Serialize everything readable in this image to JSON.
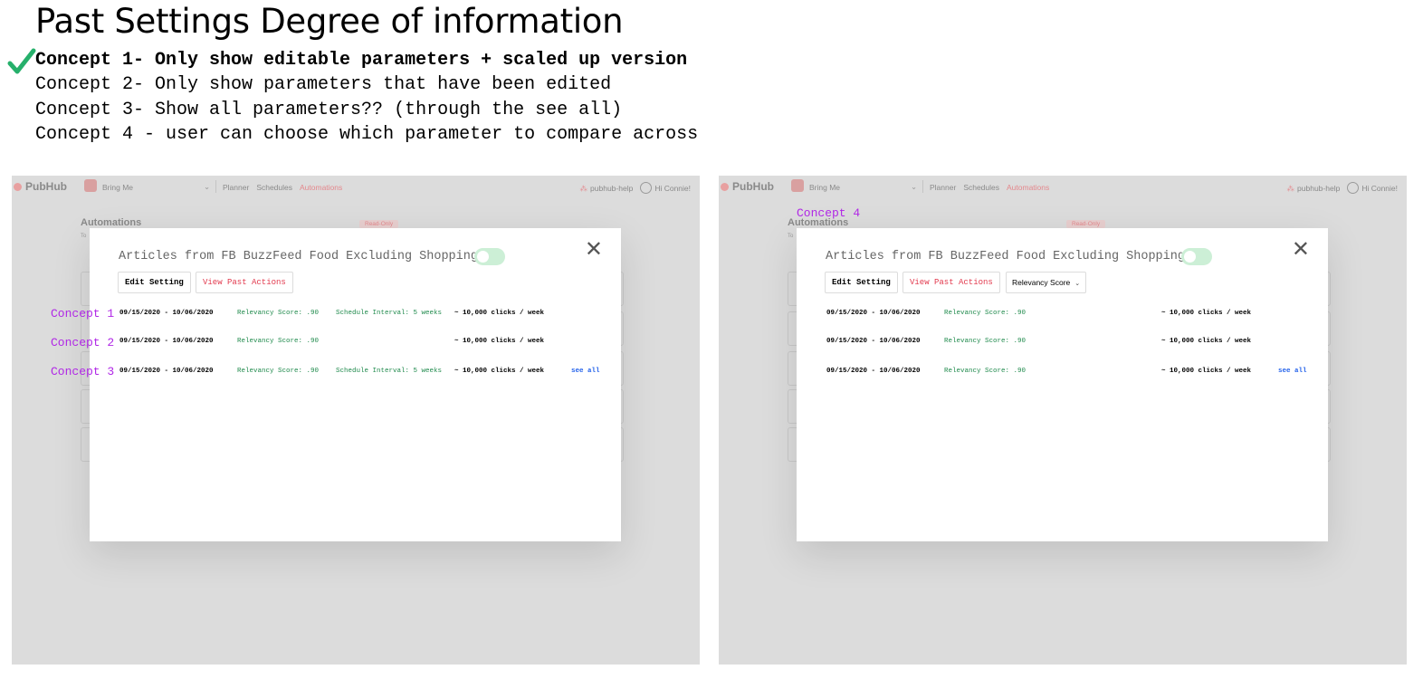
{
  "page_title": "Past Settings Degree of information",
  "concepts": [
    "Concept 1- Only show editable parameters + scaled up version",
    "Concept 2- Only show parameters that have been edited",
    "Concept 3- Show all parameters?? (through the see all)",
    "Concept 4 - user can choose which parameter to compare across"
  ],
  "colors": {
    "check": "#26b06b",
    "concept_label": "#b027e6",
    "accent_red": "#e23a4e",
    "green_text": "#1f8a4c",
    "link": "#2563eb"
  },
  "app": {
    "brand": "PubHub",
    "workspace": "Bring Me",
    "nav": [
      "Planner",
      "Schedules",
      "Automations"
    ],
    "active_nav": "Automations",
    "help": "pubhub-help",
    "user": "Hi Connie!",
    "bg_title": "Automations",
    "bg_sub": "To",
    "bg_badge": "Read-Only"
  },
  "modal": {
    "title": "Articles from FB BuzzFeed Food Excluding Shopping",
    "edit_button": "Edit Setting",
    "past_button": "View Past Actions",
    "dropdown_value": "Relevancy Score",
    "close_icon": "close-icon",
    "toggle_on": true
  },
  "left_mock": {
    "rows": [
      {
        "label": "Concept 1",
        "date": "09/15/2020 - 10/06/2020",
        "relevancy": "Relevancy Score: .90",
        "schedule": "Schedule Interval: 5 weeks",
        "clicks": "~ 10,000 clicks / week",
        "see_all": ""
      },
      {
        "label": "Concept 2",
        "date": "09/15/2020 - 10/06/2020",
        "relevancy": "Relevancy Score: .90",
        "schedule": "",
        "clicks": "~ 10,000 clicks / week",
        "see_all": ""
      },
      {
        "label": "Concept 3",
        "date": "09/15/2020 - 10/06/2020",
        "relevancy": "Relevancy Score: .90",
        "schedule": "Schedule Interval: 5 weeks",
        "clicks": "~ 10,000 clicks / week",
        "see_all": "see all"
      }
    ]
  },
  "right_mock": {
    "label": "Concept 4",
    "rows": [
      {
        "date": "09/15/2020 - 10/06/2020",
        "relevancy": "Relevancy Score: .90",
        "clicks": "~ 10,000 clicks / week",
        "see_all": ""
      },
      {
        "date": "09/15/2020 - 10/06/2020",
        "relevancy": "Relevancy Score: .90",
        "clicks": "~ 10,000 clicks / week",
        "see_all": ""
      },
      {
        "date": "09/15/2020 - 10/06/2020",
        "relevancy": "Relevancy Score: .90",
        "clicks": "~ 10,000 clicks / week",
        "see_all": "see all"
      }
    ]
  }
}
